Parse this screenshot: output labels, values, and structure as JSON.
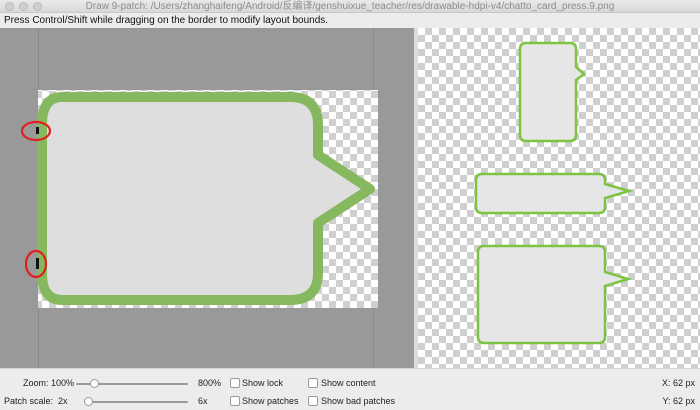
{
  "window": {
    "title": "Draw 9-patch: /Users/zhanghaifeng/Android/反编译/genshuixue_teacher/res/drawable-hdpi-v4/chatto_card_press.9.png"
  },
  "hint": "Press Control/Shift while dragging on the border to modify layout bounds.",
  "controls": {
    "zoom_label": "Zoom: 100%",
    "zoom_max": "800%",
    "zoom_value_fraction": 0.14,
    "patch_scale_label": "Patch scale:",
    "patch_scale_min": "2x",
    "patch_scale_max": "6x",
    "patch_scale_value_fraction": 0.0,
    "show_lock": "Show lock",
    "show_content": "Show content",
    "show_patches": "Show patches",
    "show_bad_patches": "Show bad patches",
    "x_readout": "X: 62 px",
    "y_readout": "Y: 62 px"
  },
  "colors": {
    "bubble_border": "#86b95f",
    "bubble_fill": "#dedede",
    "preview_border": "#7cc441",
    "preview_fill": "#e6e6e6",
    "highlight_ring": "#e11f1f"
  }
}
